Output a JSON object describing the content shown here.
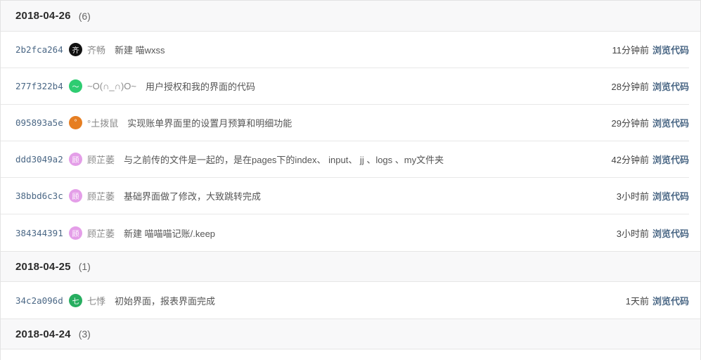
{
  "groups": [
    {
      "date": "2018-04-26",
      "count": "(6)",
      "commits": [
        {
          "sha": "2b2fca264",
          "avatar_text": "齐",
          "avatar_color": "#111111",
          "author": "齐畅",
          "message": "新建 喵wxss",
          "time": "11分钟前",
          "browse": "浏览代码"
        },
        {
          "sha": "277f322b4",
          "avatar_text": "～",
          "avatar_color": "#2ecc71",
          "author": "~O(∩_∩)O~",
          "message": "用户授权和我的界面的代码",
          "time": "28分钟前",
          "browse": "浏览代码"
        },
        {
          "sha": "095893a5e",
          "avatar_text": "°",
          "avatar_color": "#e67e22",
          "author": "°土拨鼠",
          "message": "实现账单界面里的设置月预算和明细功能",
          "time": "29分钟前",
          "browse": "浏览代码"
        },
        {
          "sha": "ddd3049a2",
          "avatar_text": "顾",
          "avatar_color": "#e49ee8",
          "author": "顾芷萎",
          "message": "与之前传的文件是一起的，是在pages下的index、 input、 jj 、logs 、my文件夹",
          "time": "42分钟前",
          "browse": "浏览代码"
        },
        {
          "sha": "38bbd6c3c",
          "avatar_text": "顾",
          "avatar_color": "#e49ee8",
          "author": "顾芷萎",
          "message": "基础界面做了修改，大致跳转完成",
          "time": "3小时前",
          "browse": "浏览代码"
        },
        {
          "sha": "384344391",
          "avatar_text": "顾",
          "avatar_color": "#e49ee8",
          "author": "顾芷萎",
          "message": "新建 喵喵喵记账/.keep",
          "time": "3小时前",
          "browse": "浏览代码"
        }
      ]
    },
    {
      "date": "2018-04-25",
      "count": "(1)",
      "commits": [
        {
          "sha": "34c2a096d",
          "avatar_text": "七",
          "avatar_color": "#27ae60",
          "author": "七悸",
          "message": "初始界面，报表界面完成",
          "time": "1天前",
          "browse": "浏览代码"
        }
      ]
    },
    {
      "date": "2018-04-24",
      "count": "(3)",
      "commits": []
    }
  ]
}
